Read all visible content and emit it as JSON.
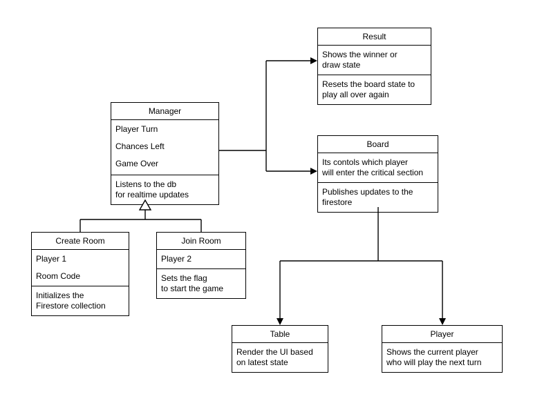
{
  "manager": {
    "title": "Manager",
    "playerTurn": "Player Turn",
    "chancesLeft": "Chances Left",
    "gameOver": "Game Over",
    "listens": "Listens to the db\nfor realtime updates"
  },
  "result": {
    "title": "Result",
    "show": "Shows the winner or\ndraw state",
    "reset": "Resets the board state to\nplay all over again"
  },
  "board": {
    "title": "Board",
    "controls": "Its contols which player\nwill enter the critical section",
    "publish": "Publishes updates to the\nfirestore"
  },
  "createRoom": {
    "title": "Create Room",
    "player1": "Player 1",
    "roomCode": "Room Code",
    "init": "Initializes the\nFirestore collection"
  },
  "joinRoom": {
    "title": "Join Room",
    "player2": "Player 2",
    "sets": "Sets the flag\nto start the game"
  },
  "table": {
    "title": "Table",
    "render": "Render the UI based\non latest state"
  },
  "player": {
    "title": "Player",
    "shows": "Shows the current player\nwho will play the next turn"
  }
}
